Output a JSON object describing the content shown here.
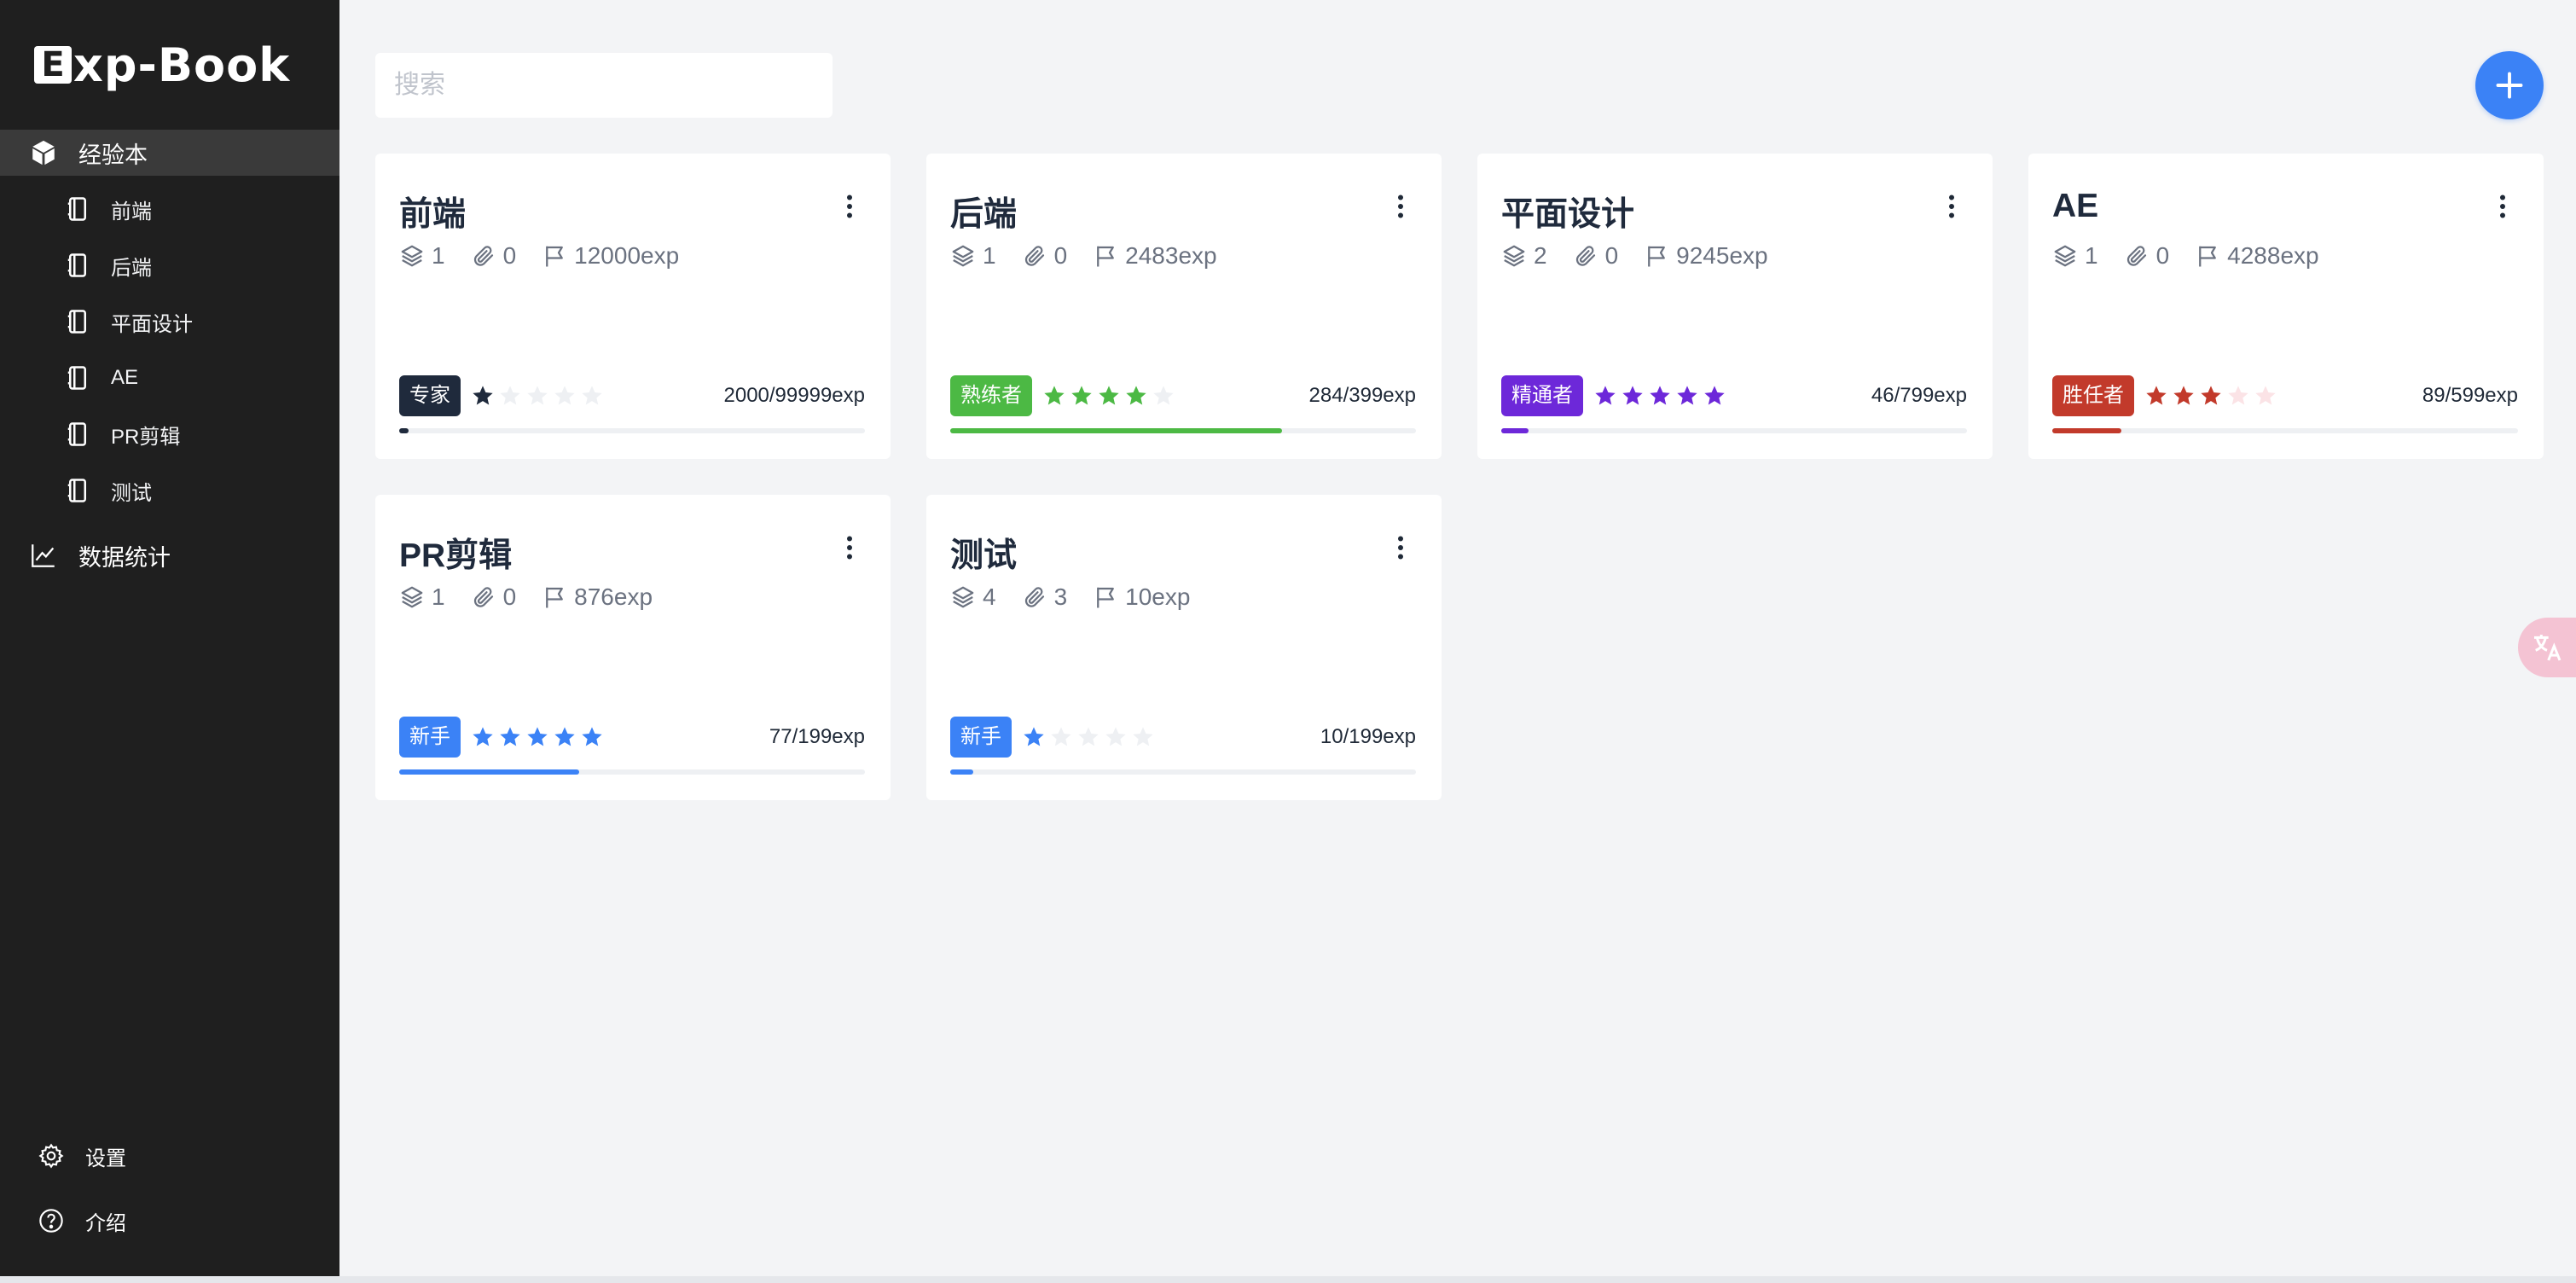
{
  "app": {
    "logo_letter": "E",
    "logo_rest": "xp-Book"
  },
  "sidebar": {
    "group_label": "经验本",
    "items": [
      {
        "label": "前端"
      },
      {
        "label": "后端"
      },
      {
        "label": "平面设计"
      },
      {
        "label": "AE"
      },
      {
        "label": "PR剪辑"
      },
      {
        "label": "测试"
      }
    ],
    "stats_label": "数据统计",
    "settings_label": "设置",
    "about_label": "介绍"
  },
  "search": {
    "placeholder": "搜索"
  },
  "colors": {
    "accent": "#3b82f6",
    "sidebar_bg": "#1f1f1f",
    "star_empty": "#eef0f3"
  },
  "cards": [
    {
      "title": "前端",
      "layers": "1",
      "attachments": "0",
      "total_exp": "12000exp",
      "level": "专家",
      "level_color": "#1f2a3c",
      "stars_filled": 1,
      "stars_total": 5,
      "progress_text": "2000/99999exp",
      "progress": 0.02
    },
    {
      "title": "后端",
      "layers": "1",
      "attachments": "0",
      "total_exp": "2483exp",
      "level": "熟练者",
      "level_color": "#4cb944",
      "stars_filled": 4,
      "stars_total": 5,
      "progress_text": "284/399exp",
      "progress": 0.712
    },
    {
      "title": "平面设计",
      "layers": "2",
      "attachments": "0",
      "total_exp": "9245exp",
      "level": "精通者",
      "level_color": "#6d28d9",
      "stars_filled": 5,
      "stars_total": 5,
      "progress_text": "46/799exp",
      "progress": 0.058
    },
    {
      "title": "AE",
      "layers": "1",
      "attachments": "0",
      "total_exp": "4288exp",
      "level": "胜任者",
      "level_color": "#c23a2b",
      "stars_filled": 3,
      "stars_total": 5,
      "progress_text": "89/599exp",
      "progress": 0.149
    },
    {
      "title": "PR剪辑",
      "layers": "1",
      "attachments": "0",
      "total_exp": "876exp",
      "level": "新手",
      "level_color": "#3b82f6",
      "stars_filled": 5,
      "stars_total": 5,
      "progress_text": "77/199exp",
      "progress": 0.387
    },
    {
      "title": "测试",
      "layers": "4",
      "attachments": "3",
      "total_exp": "10exp",
      "level": "新手",
      "level_color": "#3b82f6",
      "stars_filled": 1,
      "stars_total": 5,
      "progress_text": "10/199exp",
      "progress": 0.05
    }
  ]
}
